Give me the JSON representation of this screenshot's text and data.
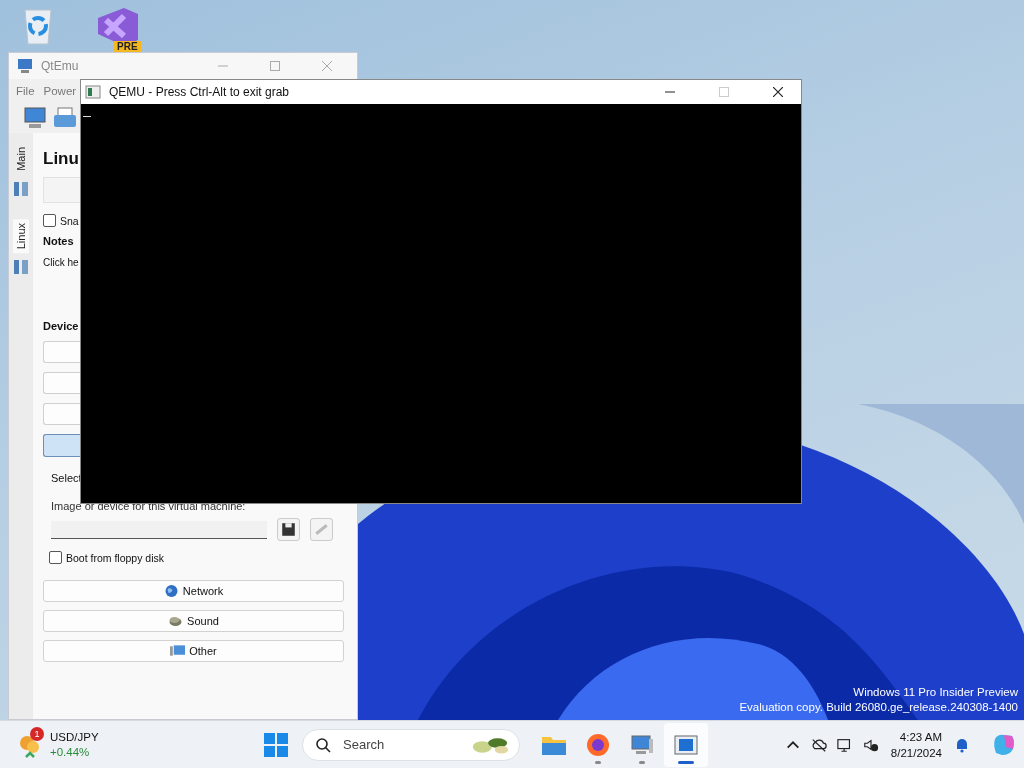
{
  "desktop_icons": [
    {
      "kind": "recycle-bin"
    },
    {
      "kind": "app-shortcut",
      "badge": "PRE"
    }
  ],
  "qtemu_window": {
    "title": "QtEmu",
    "menu": [
      "File",
      "Power"
    ],
    "side_tabs": [
      {
        "label": "Main",
        "selected": false
      },
      {
        "label": "Linux",
        "selected": true
      }
    ],
    "heading": "Linu",
    "snapshot_checkbox": {
      "label": "Sna",
      "checked": false
    },
    "notes_label": "Notes",
    "notes_text": "Click he",
    "devices_label": "Device",
    "device_tabs": [
      {
        "selected": false
      },
      {
        "selected": false
      },
      {
        "selected": false
      },
      {
        "selected": true
      }
    ],
    "select_text": "Select",
    "image_label": "Image or device for this virtual machine:",
    "floppy_checkbox": {
      "label": "Boot from floppy disk",
      "checked": false
    },
    "buttons": [
      {
        "label": "Network",
        "kind": "globe"
      },
      {
        "label": "Sound",
        "kind": "speaker"
      },
      {
        "label": "Other",
        "kind": "monitor"
      }
    ]
  },
  "qemu_window": {
    "title": "QEMU - Press Ctrl-Alt to exit grab"
  },
  "watermark": [
    "Windows 11 Pro Insider Preview",
    "Evaluation copy. Build 26080.ge_release.240308-1400"
  ],
  "taskbar": {
    "widget": {
      "badge": "1",
      "name": "USD/JPY",
      "change": "+0.44%"
    },
    "search": {
      "placeholder": "Search"
    },
    "apps": [
      {
        "kind": "folder",
        "running": false,
        "selected": false
      },
      {
        "kind": "firefox",
        "running": true,
        "selected": false
      },
      {
        "kind": "qtemu",
        "running": true,
        "selected": false
      },
      {
        "kind": "qemu",
        "running": true,
        "selected": true
      }
    ],
    "clock": {
      "time": "4:23 AM",
      "date": "8/21/2024"
    }
  }
}
